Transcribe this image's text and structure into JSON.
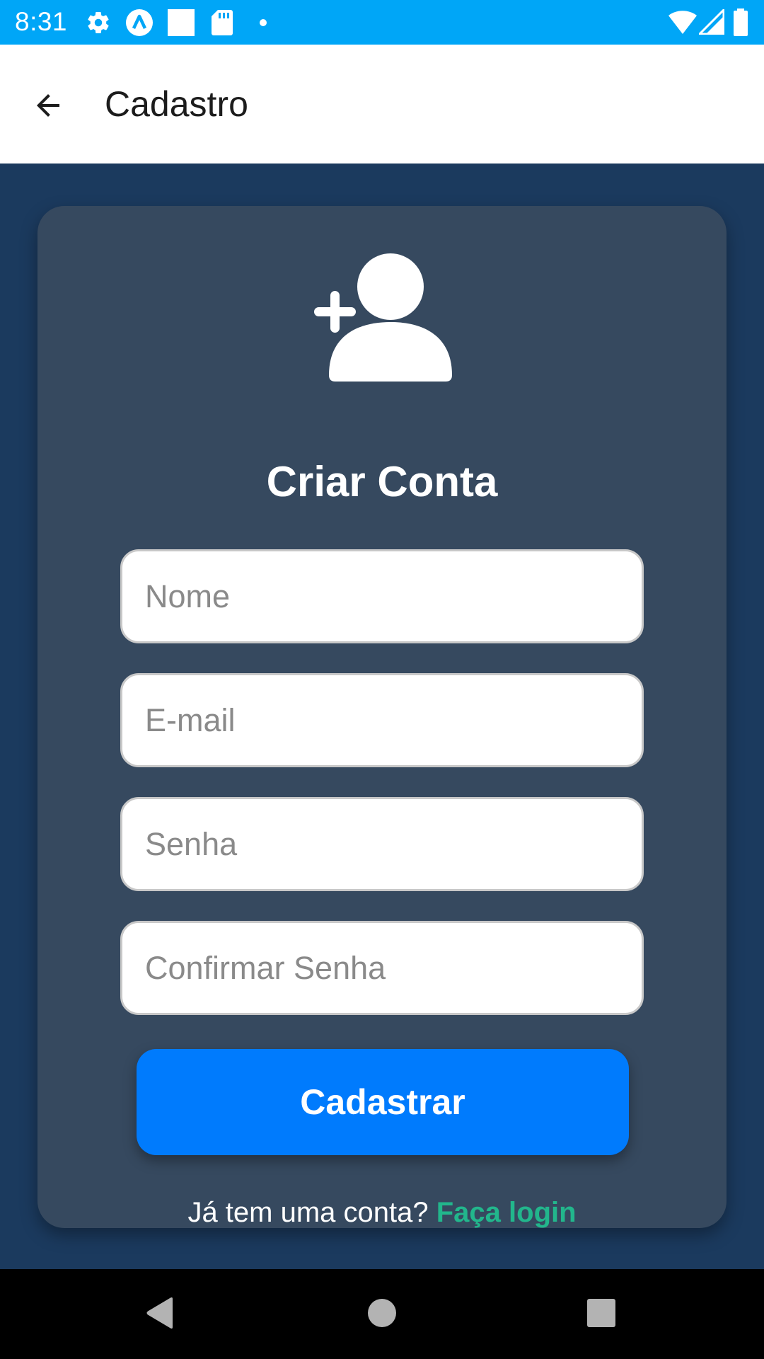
{
  "status_bar": {
    "time": "8:31",
    "left_icons": [
      "gear-icon",
      "a-circle-icon",
      "square-icon",
      "sd-card-icon",
      "dot-icon"
    ],
    "right_icons": [
      "wifi-icon",
      "signal-icon",
      "battery-icon"
    ]
  },
  "app_bar": {
    "title": "Cadastro",
    "back_icon": "arrow-back-icon"
  },
  "card": {
    "icon": "person-add-icon",
    "title": "Criar Conta",
    "fields": [
      {
        "placeholder": "Nome",
        "value": ""
      },
      {
        "placeholder": "E-mail",
        "value": ""
      },
      {
        "placeholder": "Senha",
        "value": ""
      },
      {
        "placeholder": "Confirmar Senha",
        "value": ""
      }
    ],
    "submit_label": "Cadastrar",
    "login_prompt": "Já tem uma conta?",
    "login_link": "Faça login"
  },
  "nav_bar": {
    "buttons": [
      "back-triangle-icon",
      "home-circle-icon",
      "recents-square-icon"
    ]
  },
  "colors": {
    "status_bar": "#00a6f7",
    "background": "#1b3a5e",
    "card": "#36495f",
    "primary_button": "#007bfd",
    "link": "#22b68c"
  }
}
